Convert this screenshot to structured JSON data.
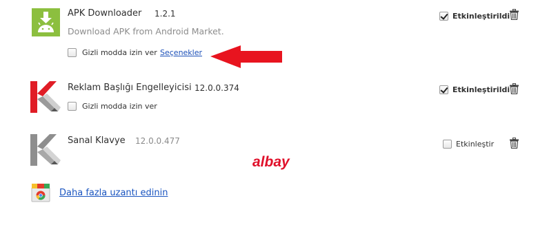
{
  "extensions": [
    {
      "name": "APK Downloader",
      "version": "1.2.1",
      "description": "Download APK from Android Market.",
      "incognito_label": "Gizli modda izin ver",
      "incognito_checked": false,
      "options_link": "Seçenekler",
      "enabled": true,
      "enable_label": "Etkinleştirildi",
      "icon": "android-download-icon"
    },
    {
      "name": "Reklam Başlığı Engelleyicisi",
      "version": "12.0.0.374",
      "incognito_label": "Gizli modda izin ver",
      "incognito_checked": false,
      "enabled": true,
      "enable_label": "Etkinleştirildi",
      "icon": "kaspersky-red-icon"
    },
    {
      "name": "Sanal Klavye",
      "version": "12.0.0.477",
      "enabled": false,
      "enable_label": "Etkinleştir",
      "icon": "kaspersky-gray-icon"
    }
  ],
  "watermark": "albay",
  "get_more": {
    "label": "Daha fazla uzantı edinin",
    "icon": "chrome-web-store-icon"
  },
  "colors": {
    "annotation_arrow": "#e8141f",
    "android_green": "#8cbf3f",
    "kaspersky_red": "#e01d26",
    "link_blue": "#1c50b8"
  }
}
